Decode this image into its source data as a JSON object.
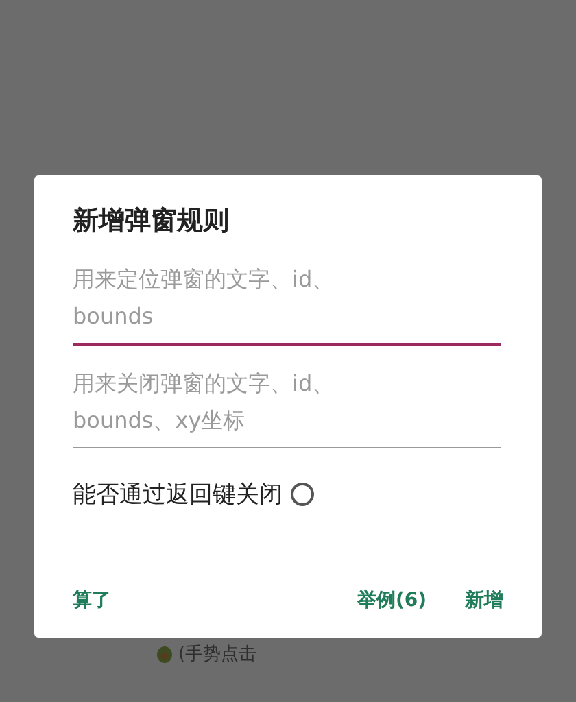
{
  "dialog": {
    "title": "新增弹窗规则",
    "fields": [
      {
        "placeholder": "用来定位弹窗的文字、id、bounds",
        "focused": true
      },
      {
        "placeholder": "用来关闭弹窗的文字、id、bounds、xy坐标",
        "focused": false
      }
    ],
    "option": {
      "label": "能否通过返回键关闭",
      "checked": false
    },
    "buttons": [
      {
        "label": "算了",
        "kind": "dismiss"
      },
      {
        "label": "举例(6)",
        "kind": "action"
      },
      {
        "label": "新增",
        "kind": "action"
      }
    ]
  },
  "background": {
    "hint": "(手势点击"
  }
}
